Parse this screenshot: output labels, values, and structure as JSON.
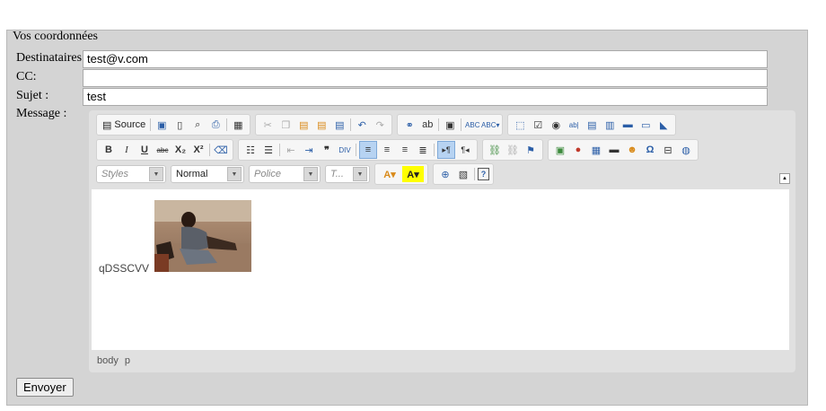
{
  "form": {
    "legend": "Vos coordonnées",
    "to_label": "Destinataires",
    "to_value": "test@v.com",
    "cc_label": "CC:",
    "cc_value": "",
    "subject_label": "Sujet :",
    "subject_value": "test",
    "message_label": "Message :",
    "send_label": "Envoyer"
  },
  "editor": {
    "toolbar1": {
      "source_label": "Source",
      "icons": [
        "save-icon",
        "new-page-icon",
        "preview-icon",
        "print-icon",
        "templates-icon",
        "cut-icon",
        "copy-icon",
        "paste-icon",
        "paste-text-icon",
        "paste-word-icon",
        "undo-icon",
        "redo-icon",
        "find-icon",
        "replace-icon",
        "select-all-icon",
        "spellcheck-icon",
        "scayt-icon",
        "form-icon",
        "checkbox-icon",
        "radio-icon",
        "textfield-icon",
        "textarea-icon",
        "select-icon",
        "button-icon",
        "imagebutton-icon",
        "hiddenfield-icon"
      ]
    },
    "toolbar2": {
      "bold": "B",
      "italic": "I",
      "underline": "U",
      "strike": "abc",
      "subscript": "X₂",
      "superscript": "X²"
    },
    "toolbar3": {
      "styles": "Styles",
      "format": "Normal",
      "font": "Police",
      "size": "T..."
    },
    "content_text": "qDSSCVV",
    "path": [
      "body",
      "p"
    ]
  },
  "colors": {
    "panel": "#d4d4d4",
    "editor_bg": "#e0e0e0",
    "active_button": "#b7d3f2"
  }
}
